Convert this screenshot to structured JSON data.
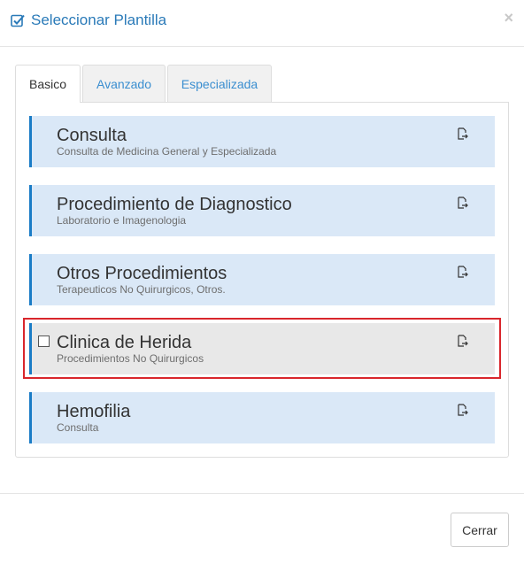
{
  "modal": {
    "title": "Seleccionar Plantilla",
    "title_icon": "checkbox-check-icon",
    "close_glyph": "×",
    "close_icon": "close-icon"
  },
  "tabs": [
    {
      "label": "Basico",
      "active": true
    },
    {
      "label": "Avanzado",
      "active": false
    },
    {
      "label": "Especializada",
      "active": false
    }
  ],
  "templates": [
    {
      "name": "Consulta",
      "description": "Consulta de Medicina General y Especializada",
      "selected": false,
      "action_icon": "export-document-icon"
    },
    {
      "name": "Procedimiento de Diagnostico",
      "description": "Laboratorio e Imagenologia",
      "selected": false,
      "action_icon": "export-document-icon"
    },
    {
      "name": "Otros Procedimientos",
      "description": "Terapeuticos No Quirurgicos, Otros.",
      "selected": false,
      "action_icon": "export-document-icon"
    },
    {
      "name": "Clinica de Herida",
      "description": "Procedimientos No Quirurgicos",
      "selected": true,
      "action_icon": "export-document-icon"
    },
    {
      "name": "Hemofilia",
      "description": "Consulta",
      "selected": false,
      "action_icon": "export-document-icon"
    }
  ],
  "footer": {
    "close_label": "Cerrar"
  },
  "colors": {
    "accent": "#2a7ab8",
    "item_background": "#dae8f7",
    "item_border": "#1a7cc6",
    "selected_background": "#e8e8e8",
    "highlight_border": "#d9262c"
  }
}
